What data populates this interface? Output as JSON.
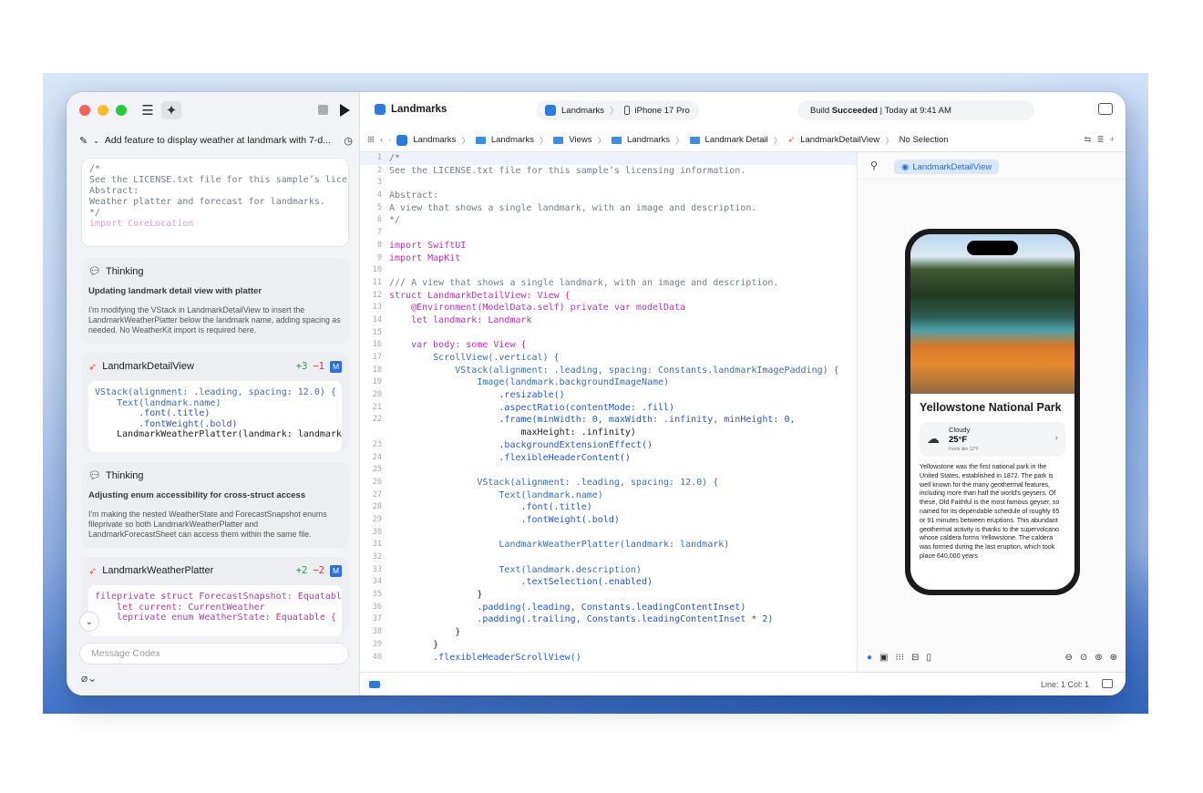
{
  "window": {
    "project": "Landmarks",
    "scheme": {
      "target": "Landmarks",
      "device": "iPhone 17 Pro"
    },
    "build_status": {
      "prefix": "Build ",
      "state": "Succeeded",
      "suffix": " | Today at 9:41 AM"
    }
  },
  "assistant": {
    "task_title": "Add feature to display weather at landmark with 7-d...",
    "top_code": [
      "/*",
      "See the LICENSE.txt file for this sample’s lice",
      "",
      "Abstract:",
      "Weather platter and forecast for landmarks.",
      "*/",
      "",
      "import CoreLocation"
    ],
    "thinking_1": {
      "label": "Thinking",
      "summary": "Updating landmark detail view with platter",
      "body": "I'm modifying the VStack in LandmarkDetailView to insert the LandmarkWeatherPlatter below the landmark name, adding spacing as needed. No WeatherKit import is required here."
    },
    "file_1": {
      "name": "LandmarkDetailView",
      "added": "+3",
      "removed": "−1",
      "badge": "M",
      "code": [
        "VStack(alignment: .leading, spacing: 12.0) {",
        "    Text(landmark.name)",
        "        .font(.title)",
        "        .fontWeight(.bold)",
        "",
        "    LandmarkWeatherPlatter(landmark: landmark)"
      ]
    },
    "thinking_2": {
      "label": "Thinking",
      "summary": "Adjusting enum accessibility for cross-struct access",
      "body": "I'm making the nested WeatherState and ForecastSnapshot enums fileprivate so both LandmarkWeatherPlatter and LandmarkForecastSheet can access them within the same file."
    },
    "file_2": {
      "name": "LandmarkWeatherPlatter",
      "added": "+2",
      "removed": "−2",
      "badge": "M",
      "code": [
        "fileprivate struct ForecastSnapshot: Equatable",
        "    let current: CurrentWeather",
        "",
        "    leprivate enum WeatherState: Equatable {"
      ]
    },
    "message_placeholder": "Message Codex"
  },
  "breadcrumb": [
    "Landmarks",
    "Landmarks",
    "Views",
    "Landmarks",
    "Landmark Detail",
    "LandmarkDetailView",
    "No Selection"
  ],
  "editor": {
    "lines": [
      {
        "n": "1",
        "t": "/*"
      },
      {
        "n": "2",
        "t": "See the LICENSE.txt file for this sample’s licensing information."
      },
      {
        "n": "3",
        "t": ""
      },
      {
        "n": "4",
        "t": "Abstract:"
      },
      {
        "n": "5",
        "t": "A view that shows a single landmark, with an image and description."
      },
      {
        "n": "6",
        "t": "*/"
      },
      {
        "n": "7",
        "t": ""
      },
      {
        "n": "8",
        "t": "import SwiftUI"
      },
      {
        "n": "9",
        "t": "import MapKit"
      },
      {
        "n": "10",
        "t": ""
      },
      {
        "n": "11",
        "t": "/// A view that shows a single landmark, with an image and description."
      },
      {
        "n": "12",
        "t": "struct LandmarkDetailView: View {"
      },
      {
        "n": "13",
        "t": "    @Environment(ModelData.self) private var modelData"
      },
      {
        "n": "14",
        "t": "    let landmark: Landmark"
      },
      {
        "n": "15",
        "t": ""
      },
      {
        "n": "16",
        "t": "    var body: some View {"
      },
      {
        "n": "17",
        "t": "        ScrollView(.vertical) {"
      },
      {
        "n": "18",
        "t": "            VStack(alignment: .leading, spacing: Constants.landmarkImagePadding) {"
      },
      {
        "n": "19",
        "t": "                Image(landmark.backgroundImageName)"
      },
      {
        "n": "20",
        "t": "                    .resizable()"
      },
      {
        "n": "21",
        "t": "                    .aspectRatio(contentMode: .fill)"
      },
      {
        "n": "22",
        "t": "                    .frame(minWidth: 0, maxWidth: .infinity, minHeight: 0,"
      },
      {
        "n": "",
        "t": "                        maxHeight: .infinity)"
      },
      {
        "n": "23",
        "t": "                    .backgroundExtensionEffect()"
      },
      {
        "n": "24",
        "t": "                    .flexibleHeaderContent()"
      },
      {
        "n": "25",
        "t": ""
      },
      {
        "n": "26",
        "t": "                VStack(alignment: .leading, spacing: 12.0) {"
      },
      {
        "n": "27",
        "t": "                    Text(landmark.name)"
      },
      {
        "n": "28",
        "t": "                        .font(.title)"
      },
      {
        "n": "29",
        "t": "                        .fontWeight(.bold)"
      },
      {
        "n": "30",
        "t": ""
      },
      {
        "n": "31",
        "t": "                    LandmarkWeatherPlatter(landmark: landmark)"
      },
      {
        "n": "32",
        "t": ""
      },
      {
        "n": "33",
        "t": "                    Text(landmark.description)"
      },
      {
        "n": "34",
        "t": "                        .textSelection(.enabled)"
      },
      {
        "n": "35",
        "t": "                }"
      },
      {
        "n": "36",
        "t": "                .padding(.leading, Constants.leadingContentInset)"
      },
      {
        "n": "37",
        "t": "                .padding(.trailing, Constants.leadingContentInset * 2)"
      },
      {
        "n": "38",
        "t": "            }"
      },
      {
        "n": "39",
        "t": "        }"
      },
      {
        "n": "40",
        "t": "        .flexibleHeaderScrollView()"
      }
    ]
  },
  "preview": {
    "tag": "LandmarkDetailView",
    "park_title": "Yellowstone National Park",
    "weather": {
      "condition": "Cloudy",
      "temp": "25°F",
      "feels": "Feels like 12°F"
    },
    "description": "Yellowstone was the first national park in the United States, established in 1872. The park is well known for the many geothermal features, including more than half the world's geysers. Of these, Old Faithful is the most famous geyser, so named for its dependable schedule of roughly 65 or 91 minutes between eruptions. This abundant geothermal activity is thanks to the supervolcano whose caldera forms Yellowstone. The caldera was formed during the last eruption, which took place 640,000 years"
  },
  "statusbar": {
    "cursor": "Line: 1  Col: 1"
  },
  "colors": {
    "accent": "#2c7be5",
    "added": "#2f9a46",
    "removed": "#d13a32"
  }
}
